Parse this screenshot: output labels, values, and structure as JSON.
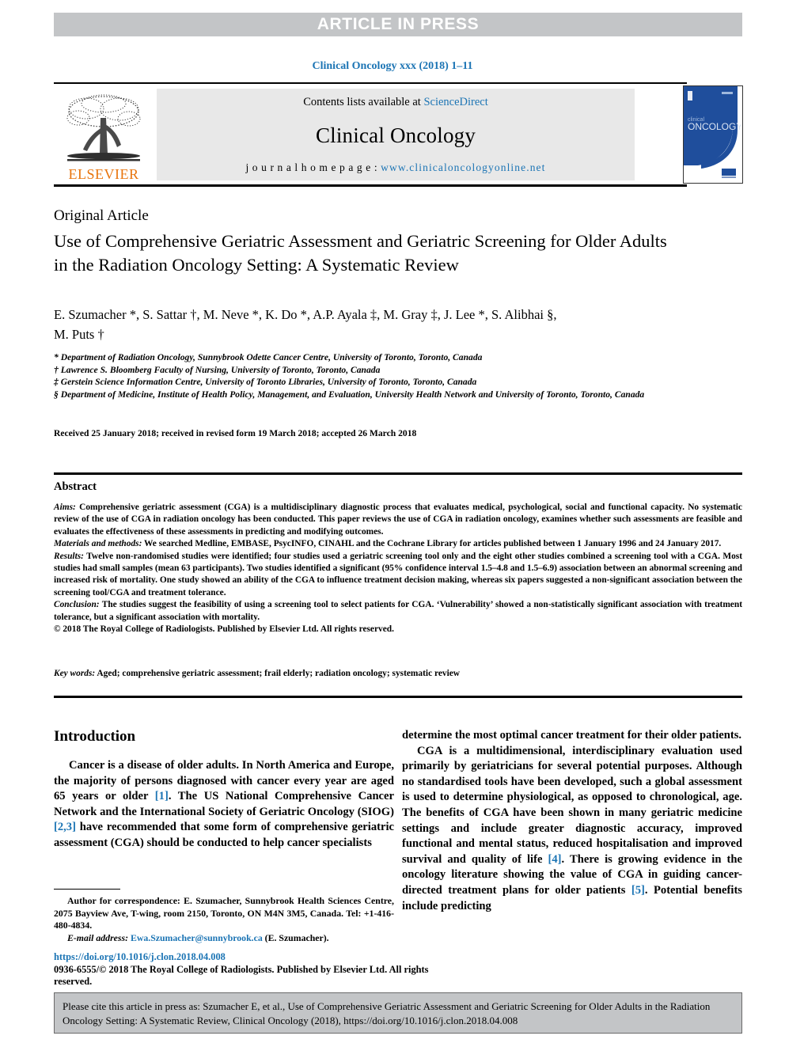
{
  "banner": {
    "label": "ARTICLE IN PRESS"
  },
  "journal_ref": "Clinical Oncology xxx (2018) 1–11",
  "masthead": {
    "contents_prefix": "Contents lists available at ",
    "contents_link": "ScienceDirect",
    "journal_title": "Clinical Oncology",
    "homepage_prefix": "j o u r n a l   h o m e p a g e :  ",
    "homepage_link": "www.clinicaloncologyonline.net",
    "publisher_name": "ELSEVIER",
    "cover_title_line1": "clinical",
    "cover_title_line2": "ONCOLOGY"
  },
  "article": {
    "type": "Original Article",
    "title": "Use of Comprehensive Geriatric Assessment and Geriatric Screening for Older Adults in the Radiation Oncology Setting: A Systematic Review",
    "authors_line1": "E. Szumacher *, S. Sattar †, M. Neve *, K. Do *, A.P. Ayala ‡, M. Gray ‡, J. Lee *, S. Alibhai §,",
    "authors_line2": "M. Puts †",
    "affiliations": [
      "* Department of Radiation Oncology, Sunnybrook Odette Cancer Centre, University of Toronto, Toronto, Canada",
      "† Lawrence S. Bloomberg Faculty of Nursing, University of Toronto, Toronto, Canada",
      "‡ Gerstein Science Information Centre, University of Toronto Libraries, University of Toronto, Toronto, Canada",
      "§ Department of Medicine, Institute of Health Policy, Management, and Evaluation, University Health Network and University of Toronto, Toronto, Canada"
    ],
    "received": "Received 25 January 2018; received in revised form 19 March 2018; accepted 26 March 2018"
  },
  "abstract": {
    "heading": "Abstract",
    "aims_label": "Aims:",
    "aims_text": " Comprehensive geriatric assessment (CGA) is a multidisciplinary diagnostic process that evaluates medical, psychological, social and functional capacity. No systematic review of the use of CGA in radiation oncology has been conducted. This paper reviews the use of CGA in radiation oncology, examines whether such assessments are feasible and evaluates the effectiveness of these assessments in predicting and modifying outcomes.",
    "methods_label": "Materials and methods:",
    "methods_text": " We searched Medline, EMBASE, PsycINFO, CINAHL and the Cochrane Library for articles published between 1 January 1996 and 24 January 2017.",
    "results_label": "Results:",
    "results_text": " Twelve non-randomised studies were identified; four studies used a geriatric screening tool only and the eight other studies combined a screening tool with a CGA. Most studies had small samples (mean 63 participants). Two studies identified a significant (95% confidence interval 1.5–4.8 and 1.5–6.9) association between an abnormal screening and increased risk of mortality. One study showed an ability of the CGA to influence treatment decision making, whereas six papers suggested a non-significant association between the screening tool/CGA and treatment tolerance.",
    "conclusion_label": "Conclusion:",
    "conclusion_text": " The studies suggest the feasibility of using a screening tool to select patients for CGA. ‘Vulnerability’ showed a non-statistically significant association with treatment tolerance, but a significant association with mortality.",
    "copyright": "© 2018 The Royal College of Radiologists. Published by Elsevier Ltd. All rights reserved.",
    "keywords_label": "Key words:",
    "keywords_text": " Aged; comprehensive geriatric assessment; frail elderly; radiation oncology; systematic review"
  },
  "body": {
    "intro_heading": "Introduction",
    "left_para1_a": "Cancer is a disease of older adults. In North America and Europe, the majority of persons diagnosed with cancer every year are aged 65 years or older ",
    "left_ref1": "[1]",
    "left_para1_b": ". The US National Comprehensive Cancer Network and the International Society of Geriatric Oncology (SIOG) ",
    "left_ref2": "[2,3]",
    "left_para1_c": " have recommended that some form of comprehensive geriatric assessment (CGA) should be conducted to help cancer specialists",
    "right_para1": "determine the most optimal cancer treatment for their older patients.",
    "right_para2_a": "CGA is a multidimensional, interdisciplinary evaluation used primarily by geriatricians for several potential purposes. Although no standardised tools have been developed, such a global assessment is used to determine physiological, as opposed to chronological, age. The benefits of CGA have been shown in many geriatric medicine settings and include greater diagnostic accuracy, improved functional and mental status, reduced hospitalisation and improved survival and quality of life ",
    "right_ref4": "[4]",
    "right_para2_b": ". There is growing evidence in the oncology literature showing the value of CGA in guiding cancer-directed treatment plans for older patients ",
    "right_ref5": "[5]",
    "right_para2_c": ". Potential benefits include predicting"
  },
  "footnote": {
    "correspondence": "Author for correspondence: E. Szumacher, Sunnybrook Health Sciences Centre, 2075 Bayview Ave, T-wing, room 2150, Toronto, ON M4N 3M5, Canada. Tel: +1-416-480-4834.",
    "email_label": "E-mail address:",
    "email_value": " Ewa.Szumacher@sunnybrook.ca",
    "email_suffix": " (E. Szumacher).",
    "doi": "https://doi.org/10.1016/j.clon.2018.04.008",
    "issn": "0936-6555/© 2018 The Royal College of Radiologists. Published by Elsevier Ltd. All rights reserved."
  },
  "citation_footer": {
    "text": "Please cite this article in press as: Szumacher E, et al., Use of Comprehensive Geriatric Assessment and Geriatric Screening for Older Adults in the Radiation Oncology Setting: A Systematic Review, Clinical Oncology (2018), https://doi.org/10.1016/j.clon.2018.04.008"
  },
  "colors": {
    "banner_bg": "#c3c5c7",
    "link_blue": "#1b74b4",
    "elsevier_orange": "#e8740c",
    "masthead_bg": "#e8e8e8",
    "cover_blue": "#1f4e9c"
  }
}
